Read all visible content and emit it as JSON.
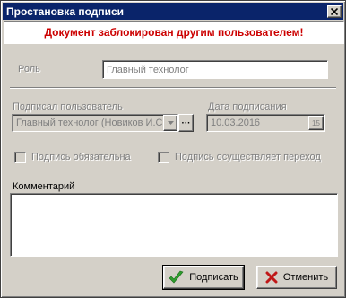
{
  "dialog": {
    "title": "Простановка подписи",
    "banner": "Документ заблокирован другим пользователем!"
  },
  "role": {
    "label": "Роль",
    "value": "Главный технолог"
  },
  "signer": {
    "label": "Подписал пользователь",
    "value": "Главный технолог (Новиков И.С.)"
  },
  "sign_date": {
    "label": "Дата подписания",
    "value": "10.03.2016",
    "calendar_label": "15"
  },
  "options": {
    "required_label": "Подпись обязательна",
    "transition_label": "Подпись осуществляет переход"
  },
  "comment": {
    "label": "Комментарий",
    "value": ""
  },
  "buttons": {
    "sign_label": "Подписать",
    "cancel_label": "Отменить",
    "ellipsis_label": "···"
  },
  "colors": {
    "title_bar": "#0a246a",
    "banner_text": "#cc0000",
    "check_icon": "#2e9e2e",
    "cancel_icon": "#c01818"
  }
}
